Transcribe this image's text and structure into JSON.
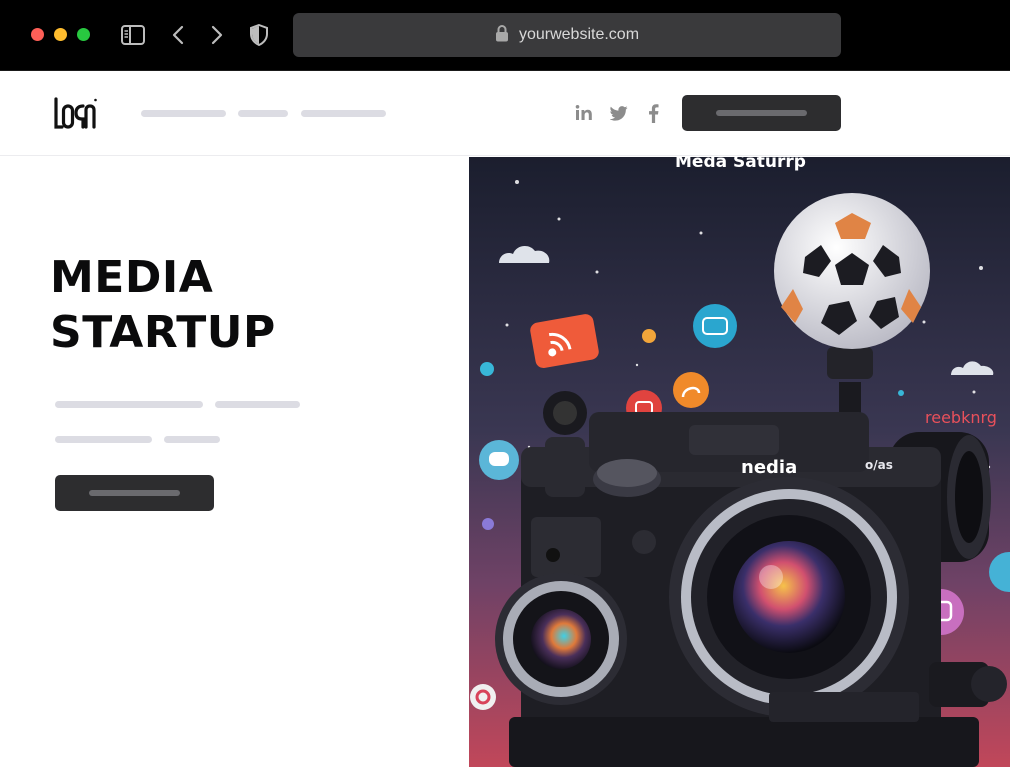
{
  "browser": {
    "url": "yourwebsite.com",
    "icons": [
      "sidebar-icon",
      "back-icon",
      "forward-icon",
      "shield-icon",
      "lock-icon"
    ]
  },
  "header": {
    "logo_text": "LOGO",
    "nav_items_count_hint": "placeholder",
    "social_icons": [
      "linkedin-icon",
      "twitter-icon",
      "facebook-icon"
    ]
  },
  "hero": {
    "title": "MEDIA\nSTARTUP"
  },
  "hero_image": {
    "caption": "Meda Saturrp",
    "camera_brand": "nedia",
    "camera_model": "o/as",
    "side_text": "reebknrg",
    "colors": {
      "top": "#1b1e2e",
      "middle": "#4a3a63",
      "bottom": "#c1475a"
    }
  },
  "colors": {
    "chrome_bg": "#000000",
    "urlbar_bg": "#3a3a3c",
    "placeholder_line": "#dcdce3",
    "button_dark": "#2d2d2f"
  }
}
